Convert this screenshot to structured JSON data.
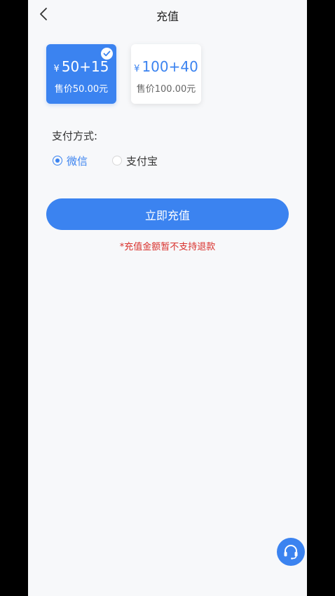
{
  "header": {
    "title": "充值",
    "back_icon": "chevron-left-icon"
  },
  "packages": [
    {
      "currency": "¥",
      "amount": "50+15",
      "price": "售价50.00元",
      "selected": true
    },
    {
      "currency": "¥",
      "amount": "100+40",
      "price": "售价100.00元",
      "selected": false
    }
  ],
  "payment": {
    "label": "支付方式:",
    "options": [
      {
        "label": "微信",
        "selected": true
      },
      {
        "label": "支付宝",
        "selected": false
      }
    ]
  },
  "submit": {
    "label": "立即充值"
  },
  "notice": "*充值金额暂不支持退款",
  "support": {
    "icon": "headset-icon"
  },
  "colors": {
    "accent": "#3b83f0",
    "warning": "#d9302c",
    "background": "#f7f8fa"
  }
}
